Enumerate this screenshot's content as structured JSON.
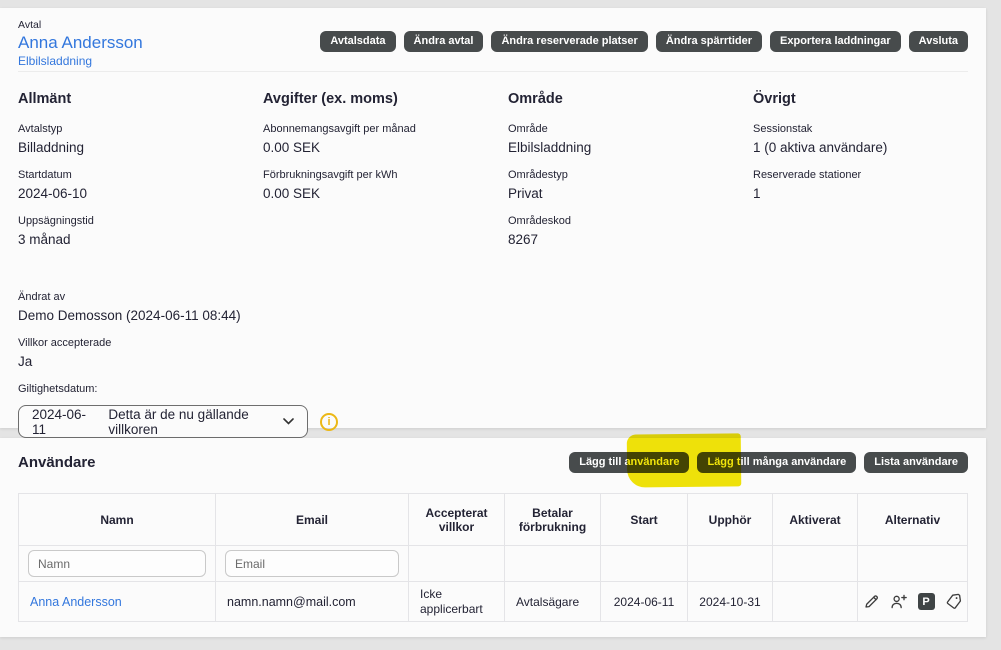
{
  "colors": {
    "link_blue": "#3377dd",
    "button_dark": "#474b4c",
    "highlight_yellow": "#f2e400",
    "info_gold": "#ecb816",
    "card_bg": "#fbfbfb",
    "page_gray": "#e4e4e4"
  },
  "header": {
    "label": "Avtal",
    "name": "Anna Andersson",
    "sublink": "Elbilsladdning",
    "buttons": [
      "Avtalsdata",
      "Ändra avtal",
      "Ändra reserverade platser",
      "Ändra spärrtider",
      "Exportera laddningar",
      "Avsluta"
    ]
  },
  "details": {
    "columns": [
      {
        "title": "Allmänt",
        "fields": [
          {
            "label": "Avtalstyp",
            "value": "Billaddning"
          },
          {
            "label": "Startdatum",
            "value": "2024-06-10"
          },
          {
            "label": "Uppsägningstid",
            "value": "3 månad"
          }
        ]
      },
      {
        "title": "Avgifter (ex. moms)",
        "fields": [
          {
            "label": "Abonnemangsavgift per månad",
            "value": "0.00 SEK"
          },
          {
            "label": "Förbrukningsavgift per kWh",
            "value": "0.00 SEK"
          }
        ]
      },
      {
        "title": "Område",
        "fields": [
          {
            "label": "Område",
            "value": "Elbilsladdning"
          },
          {
            "label": "Områdestyp",
            "value": "Privat"
          },
          {
            "label": "Områdeskod",
            "value": "8267"
          }
        ]
      },
      {
        "title": "Övrigt",
        "fields": [
          {
            "label": "Sessionstak",
            "value": "1 (0 aktiva användare)"
          },
          {
            "label": "Reserverade stationer",
            "value": "1"
          }
        ]
      }
    ],
    "meta": [
      {
        "label": "Ändrat av",
        "value": "Demo Demosson (2024-06-11 08:44)"
      },
      {
        "label": "Villkor accepterade",
        "value": "Ja"
      }
    ],
    "validity": {
      "label": "Giltighetsdatum:",
      "selected_date": "2024-06-11",
      "selected_text": "Detta är de nu gällande villkoren",
      "info_glyph": "i"
    }
  },
  "users": {
    "title": "Användare",
    "buttons": [
      "Lägg till användare",
      "Lägg till många användare",
      "Lista användare"
    ],
    "table": {
      "headers": [
        "Namn",
        "Email",
        "Accepterat villkor",
        "Betalar förbrukning",
        "Start",
        "Upphör",
        "Aktiverat",
        "Alternativ"
      ],
      "filters": {
        "namn_placeholder": "Namn",
        "email_placeholder": "Email"
      },
      "rows": [
        {
          "namn": "Anna Andersson",
          "email": "namn.namn@mail.com",
          "accepterat_villkor": "Icke applicerbart",
          "betalar_forbrukning": "Avtalsägare",
          "start": "2024-06-11",
          "upphor": "2024-10-31",
          "aktiverat": "",
          "alternativ_icons": [
            "edit-icon",
            "add-user-icon",
            "parking-icon",
            "tag-icon"
          ],
          "parking_badge_letter": "P"
        }
      ]
    }
  }
}
